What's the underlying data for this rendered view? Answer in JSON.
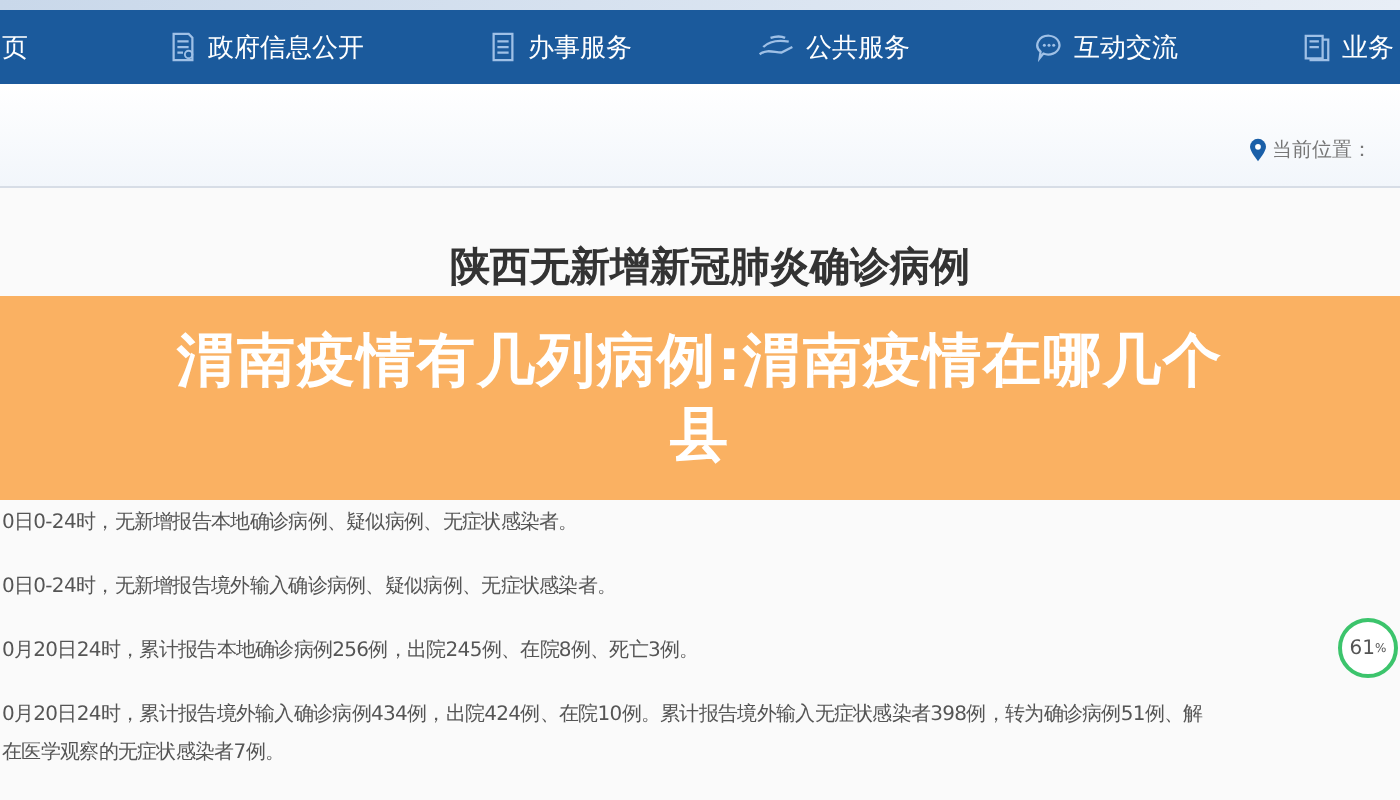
{
  "nav": {
    "items": [
      {
        "label": "页"
      },
      {
        "label": "政府信息公开"
      },
      {
        "label": "办事服务"
      },
      {
        "label": "公共服务"
      },
      {
        "label": "互动交流"
      },
      {
        "label": "业务"
      }
    ]
  },
  "breadcrumb": {
    "label": "当前位置："
  },
  "article": {
    "title": "陕西无新增新冠肺炎确诊病例",
    "paragraphs": [
      "0日0-24时，无新增报告本地确诊病例、疑似病例、无症状感染者。",
      "0日0-24时，无新增报告境外输入确诊病例、疑似病例、无症状感染者。",
      "0月20日24时，累计报告本地确诊病例256例，出院245例、在院8例、死亡3例。",
      "0月20日24时，累计报告境外输入确诊病例434例，出院424例、在院10例。累计报告境外输入无症状感染者398例，转为确诊病例51例、解",
      "在医学观察的无症状感染者7例。"
    ]
  },
  "widget": {
    "value": "61",
    "unit": "%"
  },
  "banner": {
    "lines": [
      "渭南疫情有几列病例:渭南疫情在哪几个",
      "县"
    ]
  }
}
